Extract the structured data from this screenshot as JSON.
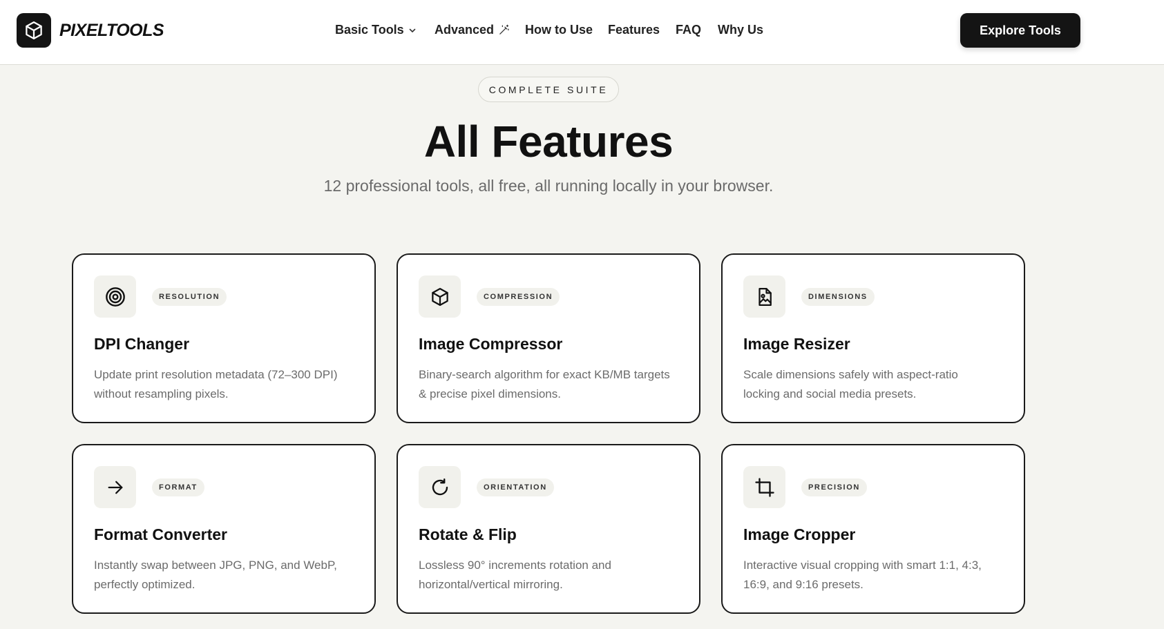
{
  "brand": {
    "name": "PIXELTOOLS"
  },
  "nav": {
    "items": [
      {
        "label": "Basic Tools",
        "icon": "chevron-down-icon"
      },
      {
        "label": "Advanced",
        "icon": "magic-wand-icon"
      },
      {
        "label": "How to Use"
      },
      {
        "label": "Features"
      },
      {
        "label": "FAQ"
      },
      {
        "label": "Why Us"
      }
    ],
    "cta_label": "Explore Tools"
  },
  "hero": {
    "badge": "COMPLETE SUITE",
    "title": "All Features",
    "subtitle": "12 professional tools, all free, all running locally in your browser."
  },
  "cards": [
    {
      "tag": "RESOLUTION",
      "title": "DPI Changer",
      "desc_line1": "Update print resolution metadata (72–300 DPI)",
      "desc_line2": "without resampling pixels.",
      "icon": "target-icon"
    },
    {
      "tag": "COMPRESSION",
      "title": "Image Compressor",
      "desc_line1": "Binary-search algorithm for exact KB/MB targets",
      "desc_line2": "& precise pixel dimensions.",
      "icon": "cube-icon"
    },
    {
      "tag": "DIMENSIONS",
      "title": "Image Resizer",
      "desc_line1": "Scale dimensions safely with aspect-ratio",
      "desc_line2": "locking and social media presets.",
      "icon": "image-file-icon"
    },
    {
      "tag": "FORMAT",
      "title": "Format Converter",
      "desc_line1": "Instantly swap between JPG, PNG, and WebP,",
      "desc_line2": "perfectly optimized.",
      "icon": "arrow-right-icon"
    },
    {
      "tag": "ORIENTATION",
      "title": "Rotate & Flip",
      "desc_line1": "Lossless 90° increments rotation and",
      "desc_line2": "horizontal/vertical mirroring.",
      "icon": "rotate-icon"
    },
    {
      "tag": "PRECISION",
      "title": "Image Cropper",
      "desc_line1": "Interactive visual cropping with smart 1:1, 4:3,",
      "desc_line2": "16:9, and 9:16 presets.",
      "icon": "crop-icon"
    }
  ]
}
